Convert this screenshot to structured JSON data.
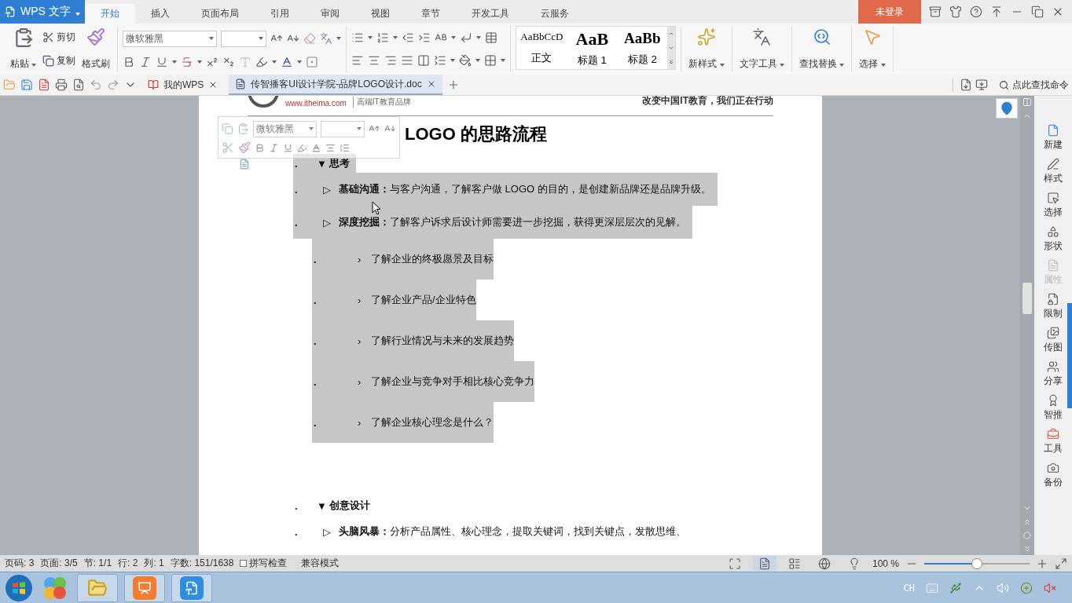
{
  "app_menu": {
    "label": "WPS 文字"
  },
  "ribbon_tabs": [
    {
      "label": "开始",
      "selected": true
    },
    {
      "label": "插入",
      "selected": false
    },
    {
      "label": "页面布局",
      "selected": false
    },
    {
      "label": "引用",
      "selected": false
    },
    {
      "label": "审阅",
      "selected": false
    },
    {
      "label": "视图",
      "selected": false
    },
    {
      "label": "章节",
      "selected": false
    },
    {
      "label": "开发工具",
      "selected": false
    },
    {
      "label": "云服务",
      "selected": false
    }
  ],
  "login_button": "未登录",
  "ribbon": {
    "clipboard": {
      "paste": "粘贴",
      "cut": "剪切",
      "copy": "复制",
      "format_painter": "格式刷"
    },
    "font": {
      "family": "微软雅黑"
    },
    "styles": [
      {
        "sample": "AaBbCcD",
        "label": "正文",
        "kind": "normal"
      },
      {
        "sample": "AaB",
        "label": "标题 1",
        "kind": "heading1"
      },
      {
        "sample": "AaBb",
        "label": "标题 2",
        "kind": "heading2"
      }
    ],
    "tools": [
      {
        "label": "新样式",
        "kind": "style"
      },
      {
        "label": "文字工具",
        "kind": "text"
      },
      {
        "label": "查找替换",
        "kind": "find"
      },
      {
        "label": "选择",
        "kind": "select"
      }
    ]
  },
  "doc_tabs": [
    {
      "label": "我的WPS",
      "selected": false
    },
    {
      "label": "传智播客UI设计学院-品牌LOGO设计.doc",
      "selected": true
    }
  ],
  "command_search": {
    "placeholder": "点此查找命令"
  },
  "document": {
    "header": {
      "url": "www.itheima.com",
      "slogan": "高端IT教育品牌",
      "motto": "改变中国IT教育，我们正在行动"
    },
    "mini_toolbar": {
      "font": "微软雅黑"
    },
    "heading": "LOGO 的思路流程",
    "outline": [
      {
        "bullet": ".",
        "marker": "▼",
        "text": "**思考**",
        "selected": true,
        "children": [
          {
            "bullet": ".",
            "marker": "▷",
            "text": "**基础沟通：**与客户沟通，了解客户做 LOGO 的目的，是创建新品牌还是品牌升级。",
            "selected": true
          },
          {
            "bullet": ".",
            "marker": "▷",
            "text": "**深度挖掘：**了解客户诉求后设计师需要进一步挖掘，获得更深层层次的见解。",
            "selected": true,
            "children": [
              {
                "bullet": ".",
                "marker": "›",
                "text": "了解企业的终极愿景及目标",
                "selected": true
              },
              {
                "bullet": ".",
                "marker": "›",
                "text": "了解企业产品/企业特色",
                "selected": true
              },
              {
                "bullet": ".",
                "marker": "›",
                "text": "了解行业情况与未来的发展趋势",
                "selected": true
              },
              {
                "bullet": ".",
                "marker": "›",
                "text": "了解企业与竞争对手相比核心竞争力",
                "selected": true
              },
              {
                "bullet": ".",
                "marker": "›",
                "text": "了解企业核心理念是什么？",
                "selected": true
              }
            ]
          }
        ]
      },
      {
        "bullet": ".",
        "marker": "▼",
        "text": "**创意设计**",
        "selected": false,
        "children": [
          {
            "bullet": ".",
            "marker": "▷",
            "text": "**头脑风暴：**分析产品属性、核心理念，提取关键词，找到关键点，发散思维、",
            "selected": false
          }
        ]
      }
    ]
  },
  "side_panel": [
    {
      "label": "新建",
      "kind": "new",
      "disabled": false
    },
    {
      "label": "样式",
      "kind": "style",
      "disabled": false
    },
    {
      "label": "选择",
      "kind": "select",
      "disabled": false
    },
    {
      "label": "形状",
      "kind": "shape",
      "disabled": false
    },
    {
      "label": "属性",
      "kind": "props",
      "disabled": true
    },
    {
      "label": "限制",
      "kind": "lock",
      "disabled": false
    },
    {
      "label": "传图",
      "kind": "image",
      "disabled": false
    },
    {
      "label": "分享",
      "kind": "share",
      "disabled": false
    },
    {
      "label": "智推",
      "kind": "award",
      "disabled": false
    },
    {
      "label": "工具",
      "kind": "tools",
      "disabled": false
    },
    {
      "label": "备份",
      "kind": "backup",
      "disabled": false
    }
  ],
  "status_bar": {
    "fields": [
      "页码: 3",
      "页面: 3/5",
      "节: 1/1",
      "行: 2",
      "列: 1",
      "字数: 151/1638"
    ],
    "spell_check": {
      "label": "拼写检查",
      "checked": false
    },
    "mode": "兼容模式",
    "views": [
      {
        "kind": "fullscreen",
        "selected": false
      },
      {
        "kind": "page",
        "selected": true
      },
      {
        "kind": "outline",
        "selected": false
      },
      {
        "kind": "web",
        "selected": false
      },
      {
        "kind": "eye",
        "selected": false
      }
    ],
    "zoom": "100 %",
    "zoom_slider": {
      "level": 0.5
    }
  },
  "taskbar": {
    "input_language": "CH"
  }
}
